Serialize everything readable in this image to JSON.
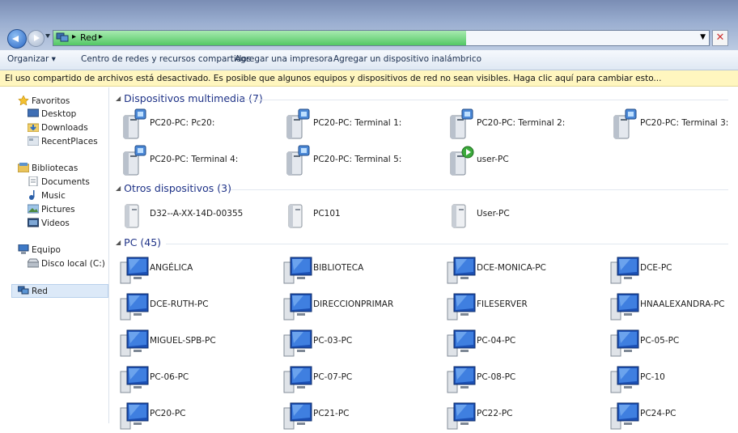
{
  "address": {
    "path_items": [
      "Red"
    ]
  },
  "toolbar": {
    "organize": "Organizar ▾",
    "items": [
      "Centro de redes y recursos compartidos",
      "Agregar una impresora",
      "Agregar un dispositivo inalámbrico"
    ]
  },
  "infobar": "El uso compartido de archivos está desactivado. Es posible que algunos equipos y dispositivos de red no sean visibles. Haga clic aquí para cambiar esto...",
  "nav": {
    "favoritos": "Favoritos",
    "favoritos_items": [
      "Desktop",
      "Downloads",
      "RecentPlaces"
    ],
    "bibliotecas": "Bibliotecas",
    "bibliotecas_items": [
      "Documents",
      "Music",
      "Pictures",
      "Videos"
    ],
    "equipo": "Equipo",
    "equipo_items": [
      "Disco local (C:)"
    ],
    "red": "Red"
  },
  "groups": [
    {
      "title": "Dispositivos multimedia (7)",
      "kind": "media",
      "items": [
        "PC20-PC: Pc20:",
        "PC20-PC: Terminal 1:",
        "PC20-PC: Terminal 2:",
        "PC20-PC: Terminal 3:",
        "PC20-PC: Terminal 4:",
        "PC20-PC: Terminal 5:",
        "user-PC"
      ]
    },
    {
      "title": "Otros dispositivos (3)",
      "kind": "device",
      "items": [
        "D32--A-XX-14D-00355",
        "PC101",
        "User-PC"
      ]
    },
    {
      "title": "PC (45)",
      "kind": "pc",
      "items": [
        "ANGÉLICA",
        "BIBLIOTECA",
        "DCE-MONICA-PC",
        "DCE-PC",
        "DCE-RUTH-PC",
        "DIRECCIONPRIMAR",
        "FILESERVER",
        "HNAALEXANDRA-PC",
        "MIGUEL-SPB-PC",
        "PC-03-PC",
        "PC-04-PC",
        "PC-05-PC",
        "PC-06-PC",
        "PC-07-PC",
        "PC-08-PC",
        "PC-10",
        "PC20-PC",
        "PC21-PC",
        "PC22-PC",
        "PC24-PC"
      ]
    }
  ],
  "colors": {
    "group_heading": "#1e3287",
    "infobar_bg": "#fff6bf",
    "selection": "#dce9f8"
  }
}
